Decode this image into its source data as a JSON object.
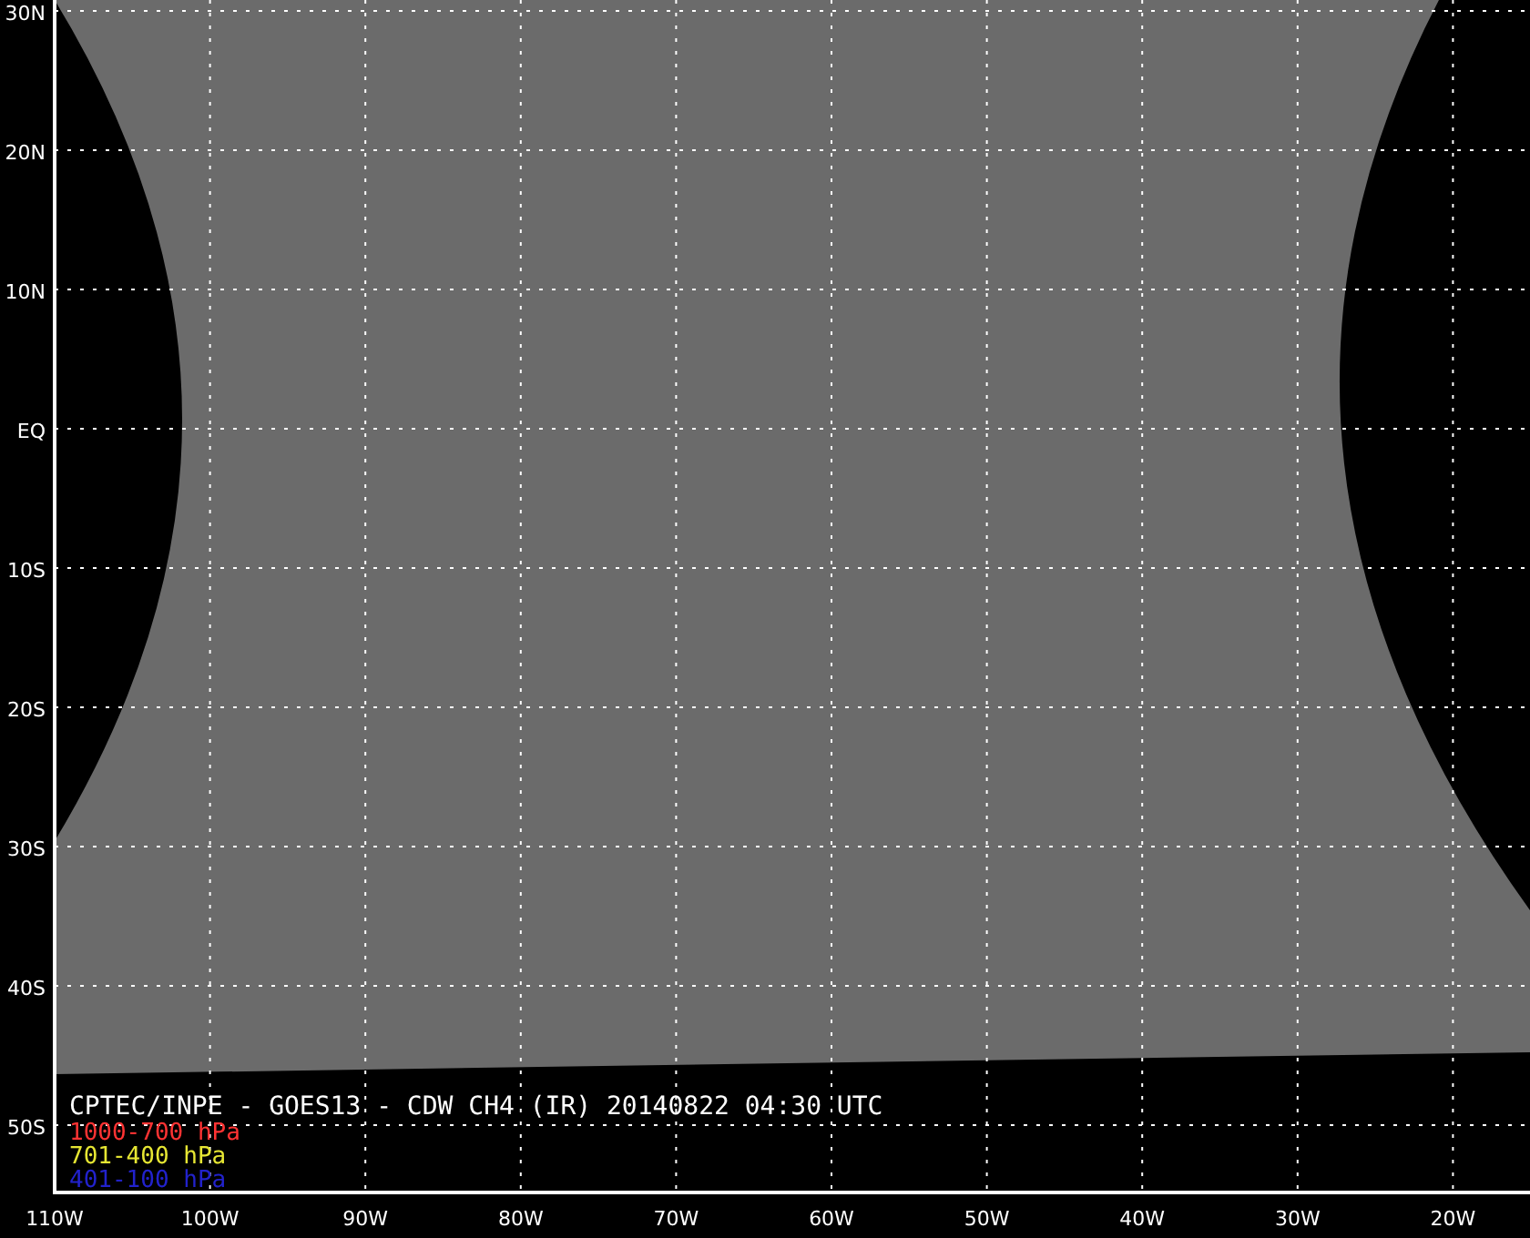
{
  "map": {
    "title": "CPTEC/INPE - GOES13 - CDW CH4 (IR) 20140822 04:30 UTC",
    "legend": [
      {
        "label": "1000-700 hPa",
        "color": "#ff3333"
      },
      {
        "label": "701-400 hPa",
        "color": "#e6e633"
      },
      {
        "label": "401-100 hPa",
        "color": "#2222cc"
      }
    ],
    "lat_labels": [
      "30N",
      "20N",
      "10N",
      "EQ",
      "10S",
      "20S",
      "30S",
      "40S",
      "50S"
    ],
    "lon_labels": [
      "110W",
      "100W",
      "90W",
      "80W",
      "70W",
      "60W",
      "50W",
      "40W",
      "30W",
      "20W"
    ]
  }
}
